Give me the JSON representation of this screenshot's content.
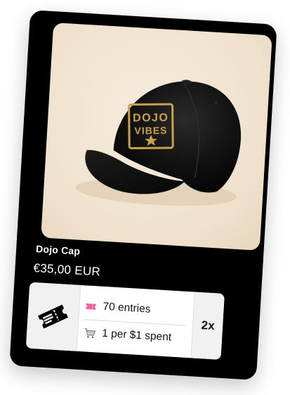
{
  "product": {
    "title": "Dojo Cap",
    "price": "€35,00 EUR",
    "image": {
      "subject": "black baseball cap with gold square patch",
      "patch_line1": "DOJO",
      "patch_line2": "VIBES",
      "patch_color": "#c9a24a",
      "cap_color": "#0d0d0d",
      "background_color": "#f2e5d1"
    }
  },
  "rewards": {
    "ticket_icon": "ticket-icon",
    "entries_icon": "pink-ticket-icon",
    "entries_label": "70 entries",
    "spend_icon": "shopping-cart-icon",
    "spend_label": "1 per $1 spent",
    "multiplier": "2x"
  },
  "colors": {
    "card_background": "#000000",
    "text_on_card": "#ffffff",
    "panel_background": "#ffffff",
    "entries_icon_color": "#f0609a"
  }
}
